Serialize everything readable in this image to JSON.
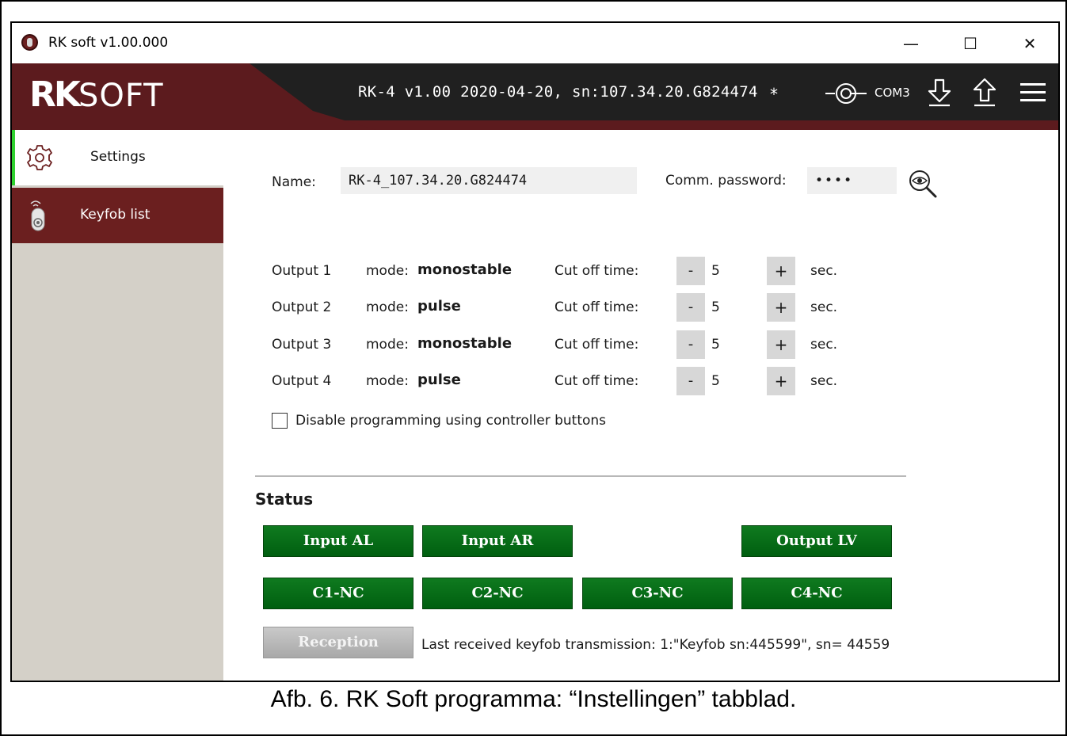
{
  "window": {
    "title": "RK soft v1.00.000",
    "minimize_glyph": "—",
    "maximize_glyph": "☐",
    "close_glyph": "✕"
  },
  "header": {
    "logo_rk": "RK",
    "logo_soft": "SOFT",
    "device_info": "RK-4 v1.00 2020-04-20, sn:107.34.20.G824474",
    "modified_mark": "*",
    "com_port": "COM3",
    "icons": [
      "connection-icon",
      "download-icon",
      "upload-icon",
      "menu-icon"
    ]
  },
  "sidebar": {
    "items": [
      {
        "label": "Settings",
        "icon": "gear-icon",
        "active": true
      },
      {
        "label": "Keyfob list",
        "icon": "keyfob-icon",
        "active": false
      }
    ]
  },
  "settings": {
    "name_label": "Name:",
    "name_value": "RK-4_107.34.20.G824474",
    "password_label": "Comm. password:",
    "password_value": "••••",
    "outputs": [
      {
        "name": "Output 1",
        "mode_label": "mode:",
        "mode": "monostable",
        "cut_label": "Cut off time:",
        "minus": "-",
        "value": "5",
        "plus": "+",
        "unit": "sec."
      },
      {
        "name": "Output 2",
        "mode_label": "mode:",
        "mode": "pulse",
        "cut_label": "Cut off time:",
        "minus": "-",
        "value": "5",
        "plus": "+",
        "unit": "sec."
      },
      {
        "name": "Output 3",
        "mode_label": "mode:",
        "mode": "monostable",
        "cut_label": "Cut off time:",
        "minus": "-",
        "value": "5",
        "plus": "+",
        "unit": "sec."
      },
      {
        "name": "Output 4",
        "mode_label": "mode:",
        "mode": "pulse",
        "cut_label": "Cut off time:",
        "minus": "-",
        "value": "5",
        "plus": "+",
        "unit": "sec."
      }
    ],
    "disable_programming_label": "Disable programming using controller buttons",
    "disable_programming_checked": false
  },
  "status": {
    "heading": "Status",
    "buttons_row1": [
      "Input AL",
      "Input AR",
      "Output LV"
    ],
    "buttons_row2": [
      "C1-NC",
      "C2-NC",
      "C3-NC",
      "C4-NC"
    ],
    "reception_label": "Reception",
    "last_transmission": "Last received keyfob transmission:   1:\"Keyfob sn:445599\", sn= 44559",
    "active_color": "#0a6e18",
    "inactive_color": "#b5b5b5"
  },
  "caption": "Afb. 6. RK Soft programma: “Instellingen” tabblad."
}
